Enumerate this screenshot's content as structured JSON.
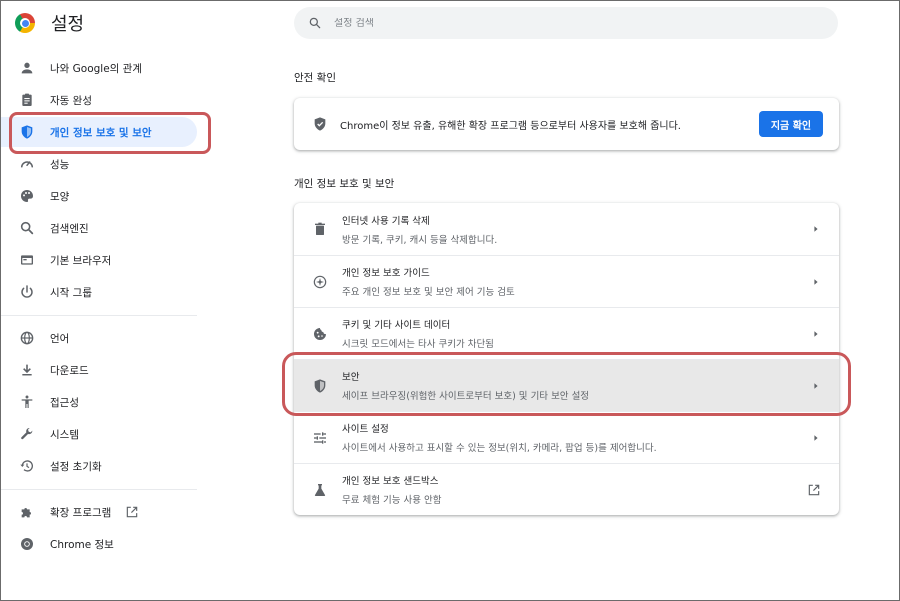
{
  "header": {
    "title": "설정",
    "search_placeholder": "설정 검색"
  },
  "sidebar": {
    "items": [
      {
        "label": "나와 Google의 관계",
        "icon": "person-icon"
      },
      {
        "label": "자동 완성",
        "icon": "clipboard-icon"
      },
      {
        "label": "개인 정보 보호 및 보안",
        "icon": "shield-icon",
        "active": true
      },
      {
        "label": "성능",
        "icon": "speedometer-icon"
      },
      {
        "label": "모양",
        "icon": "palette-icon"
      },
      {
        "label": "검색엔진",
        "icon": "search-icon"
      },
      {
        "label": "기본 브라우저",
        "icon": "browser-icon"
      },
      {
        "label": "시작 그룹",
        "icon": "power-icon"
      },
      {
        "label": "언어",
        "icon": "globe-icon"
      },
      {
        "label": "다운로드",
        "icon": "download-icon"
      },
      {
        "label": "접근성",
        "icon": "accessibility-icon"
      },
      {
        "label": "시스템",
        "icon": "wrench-icon"
      },
      {
        "label": "설정 초기화",
        "icon": "history-icon"
      },
      {
        "label": "확장 프로그램",
        "icon": "puzzle-icon"
      },
      {
        "label": "Chrome 정보",
        "icon": "chrome-icon"
      }
    ]
  },
  "safety": {
    "title": "안전 확인",
    "text": "Chrome이 정보 유출, 유해한 확장 프로그램 등으로부터 사용자를 보호해 줍니다.",
    "button": "지금 확인"
  },
  "privacy": {
    "title": "개인 정보 보호 및 보안",
    "rows": [
      {
        "title": "인터넷 사용 기록 삭제",
        "subtitle": "방문 기록, 쿠키, 캐시 등을 삭제합니다.",
        "icon": "trash-icon"
      },
      {
        "title": "개인 정보 보호 가이드",
        "subtitle": "주요 개인 정보 보호 및 보안 제어 기능 검토",
        "icon": "compass-icon"
      },
      {
        "title": "쿠키 및 기타 사이트 데이터",
        "subtitle": "시크릿 모드에서는 타사 쿠키가 차단됨",
        "icon": "cookie-icon"
      },
      {
        "title": "보안",
        "subtitle": "세이프 브라우징(위험한 사이트로부터 보호) 및 기타 보안 설정",
        "icon": "shield-icon",
        "selected": true
      },
      {
        "title": "사이트 설정",
        "subtitle": "사이트에서 사용하고 표시할 수 있는 정보(위치, 카메라, 팝업 등)를 제어합니다.",
        "icon": "sliders-icon"
      },
      {
        "title": "개인 정보 보호 샌드박스",
        "subtitle": "무료 체험 기능 사용 안함",
        "icon": "flask-icon"
      }
    ]
  },
  "colors": {
    "accent": "#1a73e8",
    "active_bg": "#e8f0fe",
    "highlight": "#c9585a"
  }
}
